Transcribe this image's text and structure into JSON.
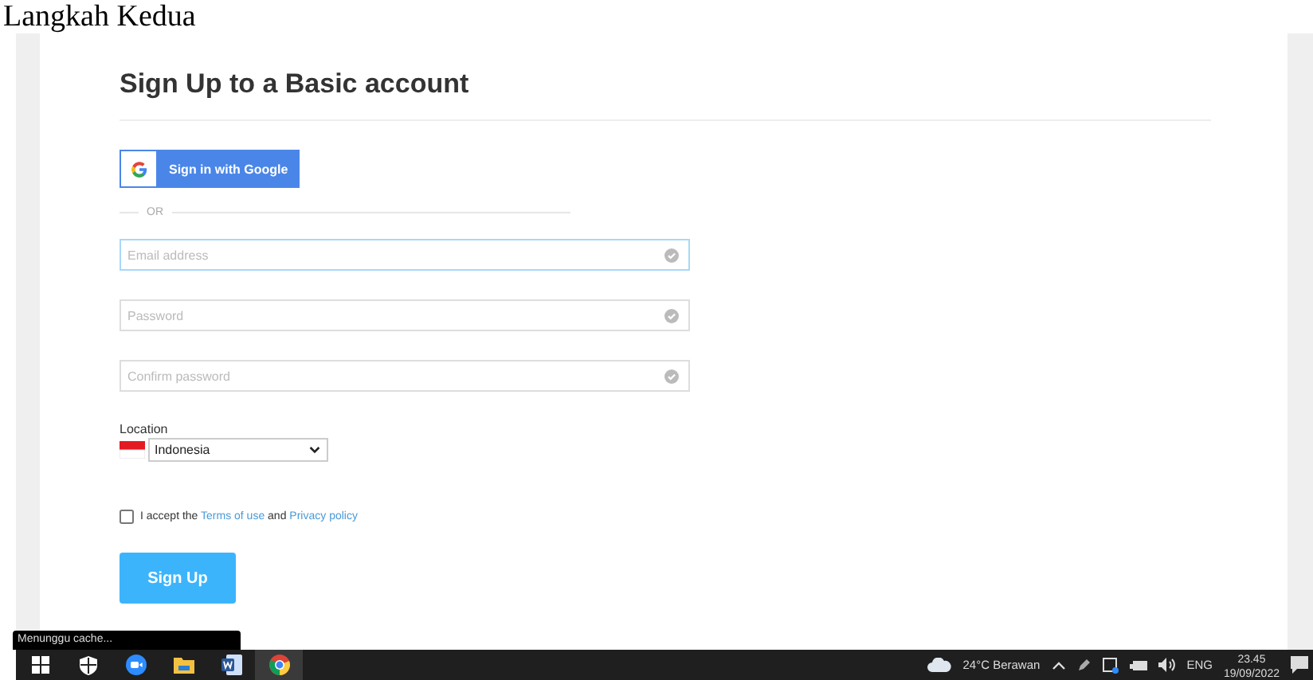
{
  "doc_heading": "Langkah Kedua",
  "page": {
    "title": "Sign Up to a Basic account",
    "google_button": "Sign in with Google",
    "divider_text": "OR",
    "fields": [
      {
        "placeholder": "Email address",
        "focused": true
      },
      {
        "placeholder": "Password",
        "focused": false
      },
      {
        "placeholder": "Confirm password",
        "focused": false
      }
    ],
    "location": {
      "label": "Location",
      "value": "Indonesia"
    },
    "terms": {
      "checked": false,
      "prefix": "I accept the",
      "link_1": "Terms of use",
      "joiner": "and",
      "link_2": "Privacy policy"
    },
    "submit": "Sign Up"
  },
  "status_tooltip": "Menunggu cache...",
  "taskbar": {
    "apps": [
      {
        "kind": "start",
        "active": false
      },
      {
        "kind": "shield",
        "active": false
      },
      {
        "kind": "video",
        "active": false
      },
      {
        "kind": "folder",
        "active": false
      },
      {
        "kind": "word",
        "active": false
      },
      {
        "kind": "chrome",
        "active": true
      }
    ],
    "weather": "24°C Berawan",
    "language": "ENG",
    "time": "23.45",
    "date": "19/09/2022"
  }
}
